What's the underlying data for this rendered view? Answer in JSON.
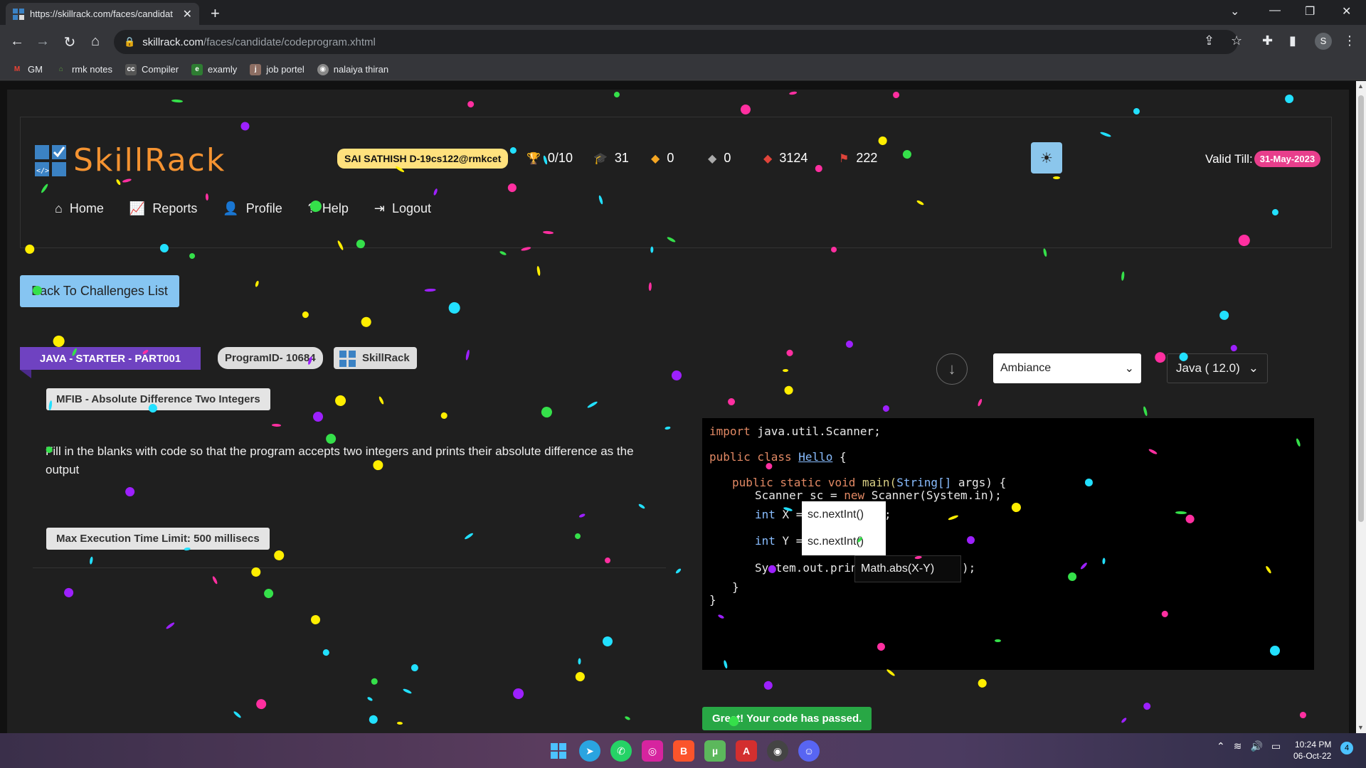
{
  "browser": {
    "tab_title": "https://skillrack.com/faces/candidat",
    "url_host": "skillrack.com",
    "url_path": "/faces/candidate/codeprogram.xhtml",
    "profile_initial": "S",
    "bookmarks": [
      {
        "label": "GM",
        "icon": "gmail-icon",
        "color": "#ea4335"
      },
      {
        "label": "rmk notes",
        "icon": "house-icon",
        "color": "#5c9d3e"
      },
      {
        "label": "Compiler",
        "icon": "cc-icon",
        "color": "#444444"
      },
      {
        "label": "examly",
        "icon": "examly-icon",
        "color": "#2e7d32"
      },
      {
        "label": "job portel",
        "icon": "job-icon",
        "color": "#8d6e63"
      },
      {
        "label": "nalaiya thiran",
        "icon": "chrome-icon",
        "color": "#888888"
      }
    ]
  },
  "header": {
    "logo_text": "SkillRack",
    "user_badge": "SAI SATHISH D-19cs122@rmkcet",
    "stats": [
      {
        "icon": "trophy-icon",
        "glyph": "🏆",
        "value": "0/10"
      },
      {
        "icon": "graduation-cap-icon",
        "glyph": "🎓",
        "value": "31"
      },
      {
        "icon": "gem-orange-icon",
        "glyph": "💎",
        "value": "0"
      },
      {
        "icon": "gem-gray-icon",
        "glyph": "💎",
        "value": "0"
      },
      {
        "icon": "gem-red-icon",
        "glyph": "💎",
        "value": "3124"
      },
      {
        "icon": "flag-icon",
        "glyph": "⚑",
        "value": "222"
      }
    ],
    "valid_label": "Valid Till:",
    "valid_date": "31-May-2023",
    "menu": [
      {
        "label": "Home",
        "icon": "home-icon",
        "glyph": "⌂"
      },
      {
        "label": "Reports",
        "icon": "chart-line-icon",
        "glyph": "📈"
      },
      {
        "label": "Profile",
        "icon": "user-icon",
        "glyph": "👤"
      },
      {
        "label": "Help",
        "icon": "question-icon",
        "glyph": "?"
      },
      {
        "label": "Logout",
        "icon": "logout-icon",
        "glyph": "⇥"
      }
    ]
  },
  "problem": {
    "back_label": "Back To Challenges List",
    "course": "JAVA - STARTER - PART001",
    "program_id": "ProgramID- 10684",
    "badge_text": "SkillRack",
    "title": "MFIB - Absolute Difference Two Integers",
    "description": "Fill in the blanks with code so that the program accepts two integers and prints their absolute difference as the output",
    "time_limit": "Max Execution Time Limit: 500 millisecs"
  },
  "editor": {
    "theme_selected": "Ambiance",
    "language_selected": "Java ( 12.0)",
    "lines": {
      "l1_kw": "import",
      "l1_rest": " java.util.Scanner;",
      "l2_kw": "public class",
      "l2_cls": "Hello",
      "l2_rest": " {",
      "l3_kw": "public static void",
      "l3_fn": " main(",
      "l3_ty": "String[]",
      "l3_rest": " args) {",
      "l4_a": "Scanner sc = ",
      "l4_kw": "new",
      "l4_b": " Scanner(System.in);",
      "l5_ty": "int",
      "l5_rest": " X = ",
      "l5_end": ";",
      "l6_ty": "int",
      "l6_rest": " Y = ",
      "l7_a": "System.out.print(",
      "l7_end": ");",
      "l8": "}",
      "l9": "}"
    },
    "blanks": {
      "x_value": "sc.nextInt()",
      "y_value": "sc.nextInt()",
      "print_value": "Math.abs(X-Y)"
    }
  },
  "status": {
    "message": "Great! Your code has passed."
  },
  "taskbar": {
    "time": "10:24 PM",
    "date": "06-Oct-22",
    "notifications": "4"
  }
}
